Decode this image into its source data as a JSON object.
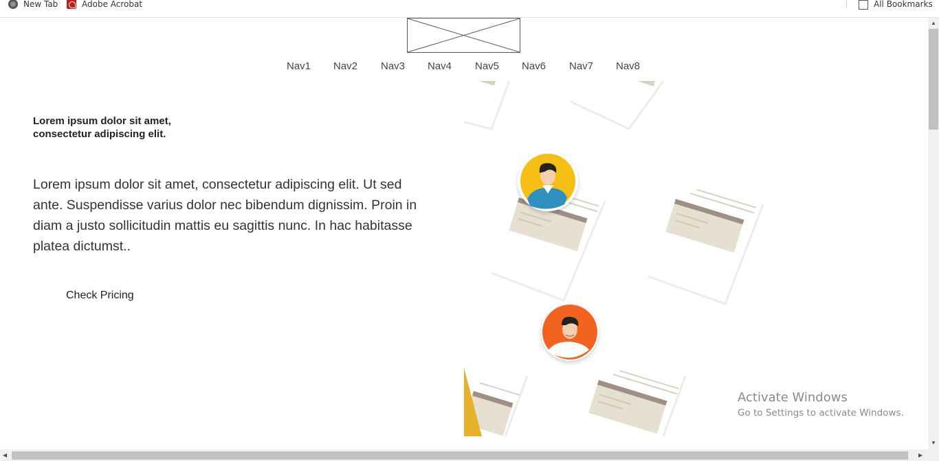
{
  "bookmarks": {
    "items": [
      {
        "label": "New Tab",
        "icon": "globe-icon"
      },
      {
        "label": "Adobe Acrobat",
        "icon": "acrobat-icon"
      }
    ],
    "all_bookmarks": {
      "label": "All Bookmarks",
      "icon": "folder-icon"
    }
  },
  "header": {
    "logo": "image-placeholder",
    "nav": [
      "Nav1",
      "Nav2",
      "Nav3",
      "Nav4",
      "Nav5",
      "Nav6",
      "Nav7",
      "Nav8"
    ]
  },
  "hero": {
    "subtitle": "Lorem ipsum dolor sit amet, consectetur adipiscing elit.",
    "body": "Lorem ipsum dolor sit amet, consectetur adipiscing elit. Ut sed ante. Suspendisse varius dolor nec bibendum dignissim. Proin in diam a justo sollicitudin mattis eu sagittis nunc. In hac habitasse platea dictumst..",
    "cta_label": "Check Pricing",
    "illustration": "profile-cards-illustration"
  },
  "watermark": {
    "title": "Activate Windows",
    "subtitle": "Go to Settings to activate Windows."
  },
  "colors": {
    "avatar_yellow": "#f5bf16",
    "avatar_orange": "#f26322",
    "card_bar": "#a08f84",
    "card_fill": "#e6e0d1",
    "accent_gold": "#e8b12b"
  }
}
